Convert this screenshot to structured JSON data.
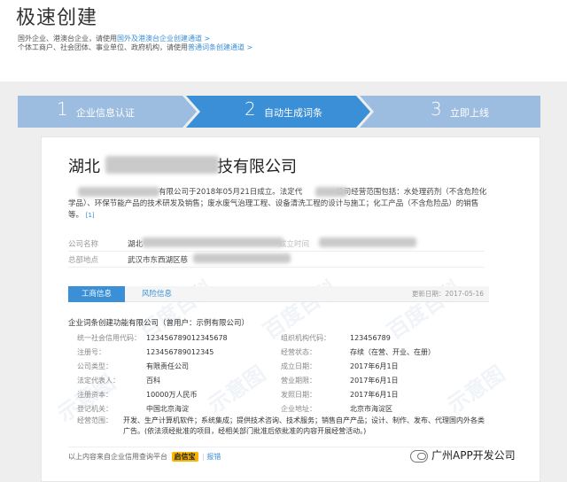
{
  "header": {
    "title": "极速创建",
    "hint1_prefix": "国外企业、港澳台企业，请使用",
    "hint1_link": "国外及港澳台企业创建通道 >",
    "hint2_prefix": "个体工商户、社会团体、事业单位、政府机构，请使用",
    "hint2_link": "普通词条创建通道 >"
  },
  "steps": [
    {
      "num": "1",
      "label": "企业信息认证",
      "state": "done"
    },
    {
      "num": "2",
      "label": "自动生成词条",
      "state": "active"
    },
    {
      "num": "3",
      "label": "立即上线",
      "state": "todo"
    }
  ],
  "colors": {
    "step_inactive": "#9dbde0",
    "step_active": "#3a8fd6",
    "link": "#3a8fd6",
    "badge": "#f7b500"
  },
  "company": {
    "name_start": "湖北",
    "name_end": "技有限公司",
    "desc_part1": "有限公司于2018年05月21日成立。法定代",
    "desc_part2": "公司经营范围包括：水处理药剂（不含危险化学品）、环保节能产品的技术研发及销售；废水废气治理工程、设备清洗工程的设计与施工；化工产品（不含危险品）的销售等。",
    "ref": "[1]",
    "name_label": "公司名称",
    "name_value": "湖北",
    "time_label": "成立时间",
    "address_label": "总部地点",
    "address_value": "武汉市东西湖区慈"
  },
  "tabs": {
    "business": "工商信息",
    "risk": "风险信息",
    "updated": "更新日期：2017-05-16"
  },
  "registration": {
    "title": "企业词条创建功能有限公司（曾用户：示例有限公司）",
    "left": [
      {
        "label": "统一社会信用代码：",
        "value": "123456789012345678"
      },
      {
        "label": "注册号：",
        "value": "123456789012345"
      },
      {
        "label": "公司类型：",
        "value": "有限责任公司"
      },
      {
        "label": "法定代表人：",
        "value": "百科"
      },
      {
        "label": "注册资本：",
        "value": "10000万人民币"
      },
      {
        "label": "登记机关：",
        "value": "中国北京海淀"
      }
    ],
    "right": [
      {
        "label": "组织机构代码：",
        "value": "123456789"
      },
      {
        "label": "经营状态：",
        "value": "存续（在营、开业、在册）"
      },
      {
        "label": "成立日期：",
        "value": "2017年6月1日"
      },
      {
        "label": "营业期限：",
        "value": "2017年6月1日"
      },
      {
        "label": "发照日期：",
        "value": "2017年6月1日"
      },
      {
        "label": "企业地址：",
        "value": "北京市海淀区"
      }
    ],
    "scope_label": "经营范围：",
    "scope_text": "开发、生产计算机软件；系统集成；提供技术咨询、技术服务；销售自产产品；设计、制作、发布、代理国内外各类广告。(依法须经批准的项目，经相关部门批准后依批准的内容开展经营活动。)"
  },
  "source": {
    "prefix": "以上内容来自企业信用查询平台",
    "badge": "启信宝",
    "sep": "|",
    "report": "报错"
  },
  "watermark": {
    "text1": "百度百科",
    "text2": "示意图"
  },
  "wechat": {
    "label": "广州APP开发公司"
  }
}
